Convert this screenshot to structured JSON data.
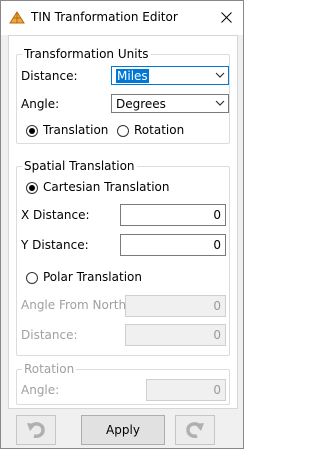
{
  "window": {
    "title": "TIN Tranformation Editor"
  },
  "units": {
    "legend": "Transformation Units",
    "distance_label": "Distance:",
    "distance_value": "Miles",
    "angle_label": "Angle:",
    "angle_value": "Degrees",
    "translation_label": "Translation",
    "rotation_label": "Rotation"
  },
  "spatial": {
    "legend": "Spatial Translation",
    "cartesian_label": "Cartesian Translation",
    "x_label": "X Distance:",
    "x_value": "0",
    "y_label": "Y Distance:",
    "y_value": "0",
    "polar_label": "Polar Translation",
    "angle_north_label": "Angle From North:",
    "angle_north_value": "0",
    "polar_distance_label": "Distance:",
    "polar_distance_value": "0"
  },
  "rotation": {
    "legend": "Rotation",
    "angle_label": "Angle:",
    "angle_value": "0"
  },
  "footer": {
    "apply_label": "Apply"
  }
}
